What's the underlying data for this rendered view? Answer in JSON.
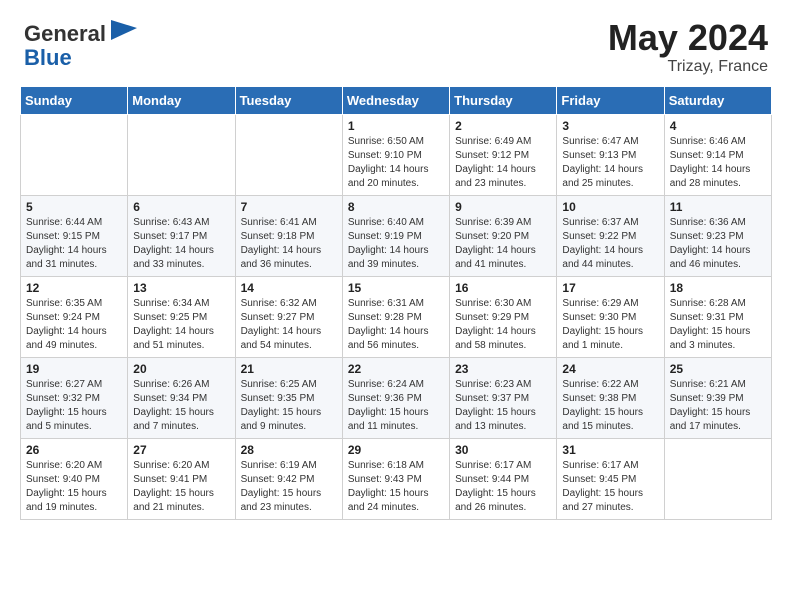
{
  "header": {
    "logo_general": "General",
    "logo_blue": "Blue",
    "main_title": "May 2024",
    "subtitle": "Trizay, France"
  },
  "weekdays": [
    "Sunday",
    "Monday",
    "Tuesday",
    "Wednesday",
    "Thursday",
    "Friday",
    "Saturday"
  ],
  "weeks": [
    [
      {
        "day": "",
        "info": ""
      },
      {
        "day": "",
        "info": ""
      },
      {
        "day": "",
        "info": ""
      },
      {
        "day": "1",
        "info": "Sunrise: 6:50 AM\nSunset: 9:10 PM\nDaylight: 14 hours\nand 20 minutes."
      },
      {
        "day": "2",
        "info": "Sunrise: 6:49 AM\nSunset: 9:12 PM\nDaylight: 14 hours\nand 23 minutes."
      },
      {
        "day": "3",
        "info": "Sunrise: 6:47 AM\nSunset: 9:13 PM\nDaylight: 14 hours\nand 25 minutes."
      },
      {
        "day": "4",
        "info": "Sunrise: 6:46 AM\nSunset: 9:14 PM\nDaylight: 14 hours\nand 28 minutes."
      }
    ],
    [
      {
        "day": "5",
        "info": "Sunrise: 6:44 AM\nSunset: 9:15 PM\nDaylight: 14 hours\nand 31 minutes."
      },
      {
        "day": "6",
        "info": "Sunrise: 6:43 AM\nSunset: 9:17 PM\nDaylight: 14 hours\nand 33 minutes."
      },
      {
        "day": "7",
        "info": "Sunrise: 6:41 AM\nSunset: 9:18 PM\nDaylight: 14 hours\nand 36 minutes."
      },
      {
        "day": "8",
        "info": "Sunrise: 6:40 AM\nSunset: 9:19 PM\nDaylight: 14 hours\nand 39 minutes."
      },
      {
        "day": "9",
        "info": "Sunrise: 6:39 AM\nSunset: 9:20 PM\nDaylight: 14 hours\nand 41 minutes."
      },
      {
        "day": "10",
        "info": "Sunrise: 6:37 AM\nSunset: 9:22 PM\nDaylight: 14 hours\nand 44 minutes."
      },
      {
        "day": "11",
        "info": "Sunrise: 6:36 AM\nSunset: 9:23 PM\nDaylight: 14 hours\nand 46 minutes."
      }
    ],
    [
      {
        "day": "12",
        "info": "Sunrise: 6:35 AM\nSunset: 9:24 PM\nDaylight: 14 hours\nand 49 minutes."
      },
      {
        "day": "13",
        "info": "Sunrise: 6:34 AM\nSunset: 9:25 PM\nDaylight: 14 hours\nand 51 minutes."
      },
      {
        "day": "14",
        "info": "Sunrise: 6:32 AM\nSunset: 9:27 PM\nDaylight: 14 hours\nand 54 minutes."
      },
      {
        "day": "15",
        "info": "Sunrise: 6:31 AM\nSunset: 9:28 PM\nDaylight: 14 hours\nand 56 minutes."
      },
      {
        "day": "16",
        "info": "Sunrise: 6:30 AM\nSunset: 9:29 PM\nDaylight: 14 hours\nand 58 minutes."
      },
      {
        "day": "17",
        "info": "Sunrise: 6:29 AM\nSunset: 9:30 PM\nDaylight: 15 hours\nand 1 minute."
      },
      {
        "day": "18",
        "info": "Sunrise: 6:28 AM\nSunset: 9:31 PM\nDaylight: 15 hours\nand 3 minutes."
      }
    ],
    [
      {
        "day": "19",
        "info": "Sunrise: 6:27 AM\nSunset: 9:32 PM\nDaylight: 15 hours\nand 5 minutes."
      },
      {
        "day": "20",
        "info": "Sunrise: 6:26 AM\nSunset: 9:34 PM\nDaylight: 15 hours\nand 7 minutes."
      },
      {
        "day": "21",
        "info": "Sunrise: 6:25 AM\nSunset: 9:35 PM\nDaylight: 15 hours\nand 9 minutes."
      },
      {
        "day": "22",
        "info": "Sunrise: 6:24 AM\nSunset: 9:36 PM\nDaylight: 15 hours\nand 11 minutes."
      },
      {
        "day": "23",
        "info": "Sunrise: 6:23 AM\nSunset: 9:37 PM\nDaylight: 15 hours\nand 13 minutes."
      },
      {
        "day": "24",
        "info": "Sunrise: 6:22 AM\nSunset: 9:38 PM\nDaylight: 15 hours\nand 15 minutes."
      },
      {
        "day": "25",
        "info": "Sunrise: 6:21 AM\nSunset: 9:39 PM\nDaylight: 15 hours\nand 17 minutes."
      }
    ],
    [
      {
        "day": "26",
        "info": "Sunrise: 6:20 AM\nSunset: 9:40 PM\nDaylight: 15 hours\nand 19 minutes."
      },
      {
        "day": "27",
        "info": "Sunrise: 6:20 AM\nSunset: 9:41 PM\nDaylight: 15 hours\nand 21 minutes."
      },
      {
        "day": "28",
        "info": "Sunrise: 6:19 AM\nSunset: 9:42 PM\nDaylight: 15 hours\nand 23 minutes."
      },
      {
        "day": "29",
        "info": "Sunrise: 6:18 AM\nSunset: 9:43 PM\nDaylight: 15 hours\nand 24 minutes."
      },
      {
        "day": "30",
        "info": "Sunrise: 6:17 AM\nSunset: 9:44 PM\nDaylight: 15 hours\nand 26 minutes."
      },
      {
        "day": "31",
        "info": "Sunrise: 6:17 AM\nSunset: 9:45 PM\nDaylight: 15 hours\nand 27 minutes."
      },
      {
        "day": "",
        "info": ""
      }
    ]
  ]
}
